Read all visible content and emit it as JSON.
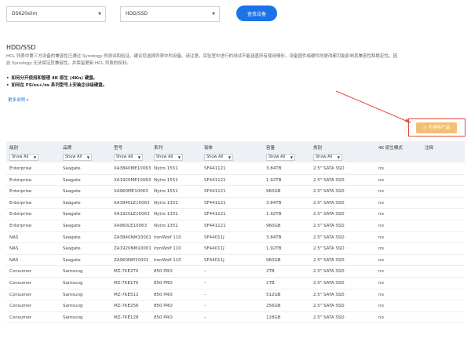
{
  "top": {
    "model_select": "DS620slim",
    "category_select": "HDD/SSD",
    "query_button": "查找设备"
  },
  "section": {
    "title": "HDD/SSD",
    "desc_line1": "HCL 列表中第三方设备的兼容性已通过 Synology 的测试和验证。建议您选择列表中的设备。请注意，实验室中进行的测试不能涵盖所有使用情形，设备固件或硬件的更改都可能影响其兼容性和稳定性。因",
    "desc_line2": "此 Synology 无法保证其兼容性，并保留更新 HCL 列表的权利。",
    "bullet1": "如何分开使用和管理 4K 原生 (4Kn) 硬盘。",
    "bullet2": "如何在 FS/xs+/xs 系列型号上安装企业级硬盘。",
    "more_label": "更多说明",
    "compat_button": "不兼容产品"
  },
  "icons": {
    "select_chevron": "chevron-down-icon",
    "warning": "warning-icon"
  },
  "colors": {
    "primary": "#1a73e8",
    "warning_button": "#f2c072",
    "callout_red": "#e64a3c",
    "header_bg": "#edf1f5"
  },
  "table": {
    "columns": [
      "级别",
      "品牌",
      "型号",
      "系列",
      "韧体",
      "容量",
      "类别",
      "4K 原生模式",
      "注释"
    ],
    "filter_label": "Show All",
    "rows": [
      [
        "Enterprise",
        "Seagate",
        "XA3840ME10063",
        "Nytro 1551",
        "SF441121",
        "3.84TB",
        "2.5\" SATA SSD",
        "no",
        ""
      ],
      [
        "Enterprise",
        "Seagate",
        "XA1920ME10063",
        "Nytro 1551",
        "SF441121",
        "1.92TB",
        "2.5\" SATA SSD",
        "no",
        ""
      ],
      [
        "Enterprise",
        "Seagate",
        "XA960ME10063",
        "Nytro 1551",
        "SF441121",
        "960GB",
        "2.5\" SATA SSD",
        "no",
        ""
      ],
      [
        "Enterprise",
        "Seagate",
        "XA3840LE10063",
        "Nytro 1351",
        "SF441121",
        "3.84TB",
        "2.5\" SATA SSD",
        "no",
        ""
      ],
      [
        "Enterprise",
        "Seagate",
        "XA1920LE10063",
        "Nytro 1351",
        "SF441121",
        "1.92TB",
        "2.5\" SATA SSD",
        "no",
        ""
      ],
      [
        "Enterprise",
        "Seagate",
        "XA960LE10063",
        "Nytro 1351",
        "SF441121",
        "960GB",
        "2.5\" SATA SSD",
        "no",
        ""
      ],
      [
        "NAS",
        "Seagate",
        "ZA3840NM10001",
        "IronWolf 110",
        "SF44011J",
        "3.84TB",
        "2.5\" SATA SSD",
        "no",
        ""
      ],
      [
        "NAS",
        "Seagate",
        "ZA1920NM10001",
        "IronWolf 110",
        "SF44011J",
        "1.92TB",
        "2.5\" SATA SSD",
        "no",
        ""
      ],
      [
        "NAS",
        "Seagate",
        "ZA960NM10001",
        "IronWolf 110",
        "SF44011J",
        "960GB",
        "2.5\" SATA SSD",
        "no",
        ""
      ],
      [
        "Consumer",
        "Samsung",
        "MZ-7KE2T0",
        "850 PRO",
        "–",
        "2TB",
        "2.5\" SATA SSD",
        "no",
        ""
      ],
      [
        "Consumer",
        "Samsung",
        "MZ-7KE1T0",
        "850 PRO",
        "–",
        "1TB",
        "2.5\" SATA SSD",
        "no",
        ""
      ],
      [
        "Consumer",
        "Samsung",
        "MZ-7KE512",
        "850 PRO",
        "–",
        "512GB",
        "2.5\" SATA SSD",
        "no",
        ""
      ],
      [
        "Consumer",
        "Samsung",
        "MZ-7KE256",
        "850 PRO",
        "–",
        "256GB",
        "2.5\" SATA SSD",
        "no",
        ""
      ],
      [
        "Consumer",
        "Samsung",
        "MZ-7KE128",
        "850 PRO",
        "–",
        "128GB",
        "2.5\" SATA SSD",
        "no",
        ""
      ]
    ]
  }
}
